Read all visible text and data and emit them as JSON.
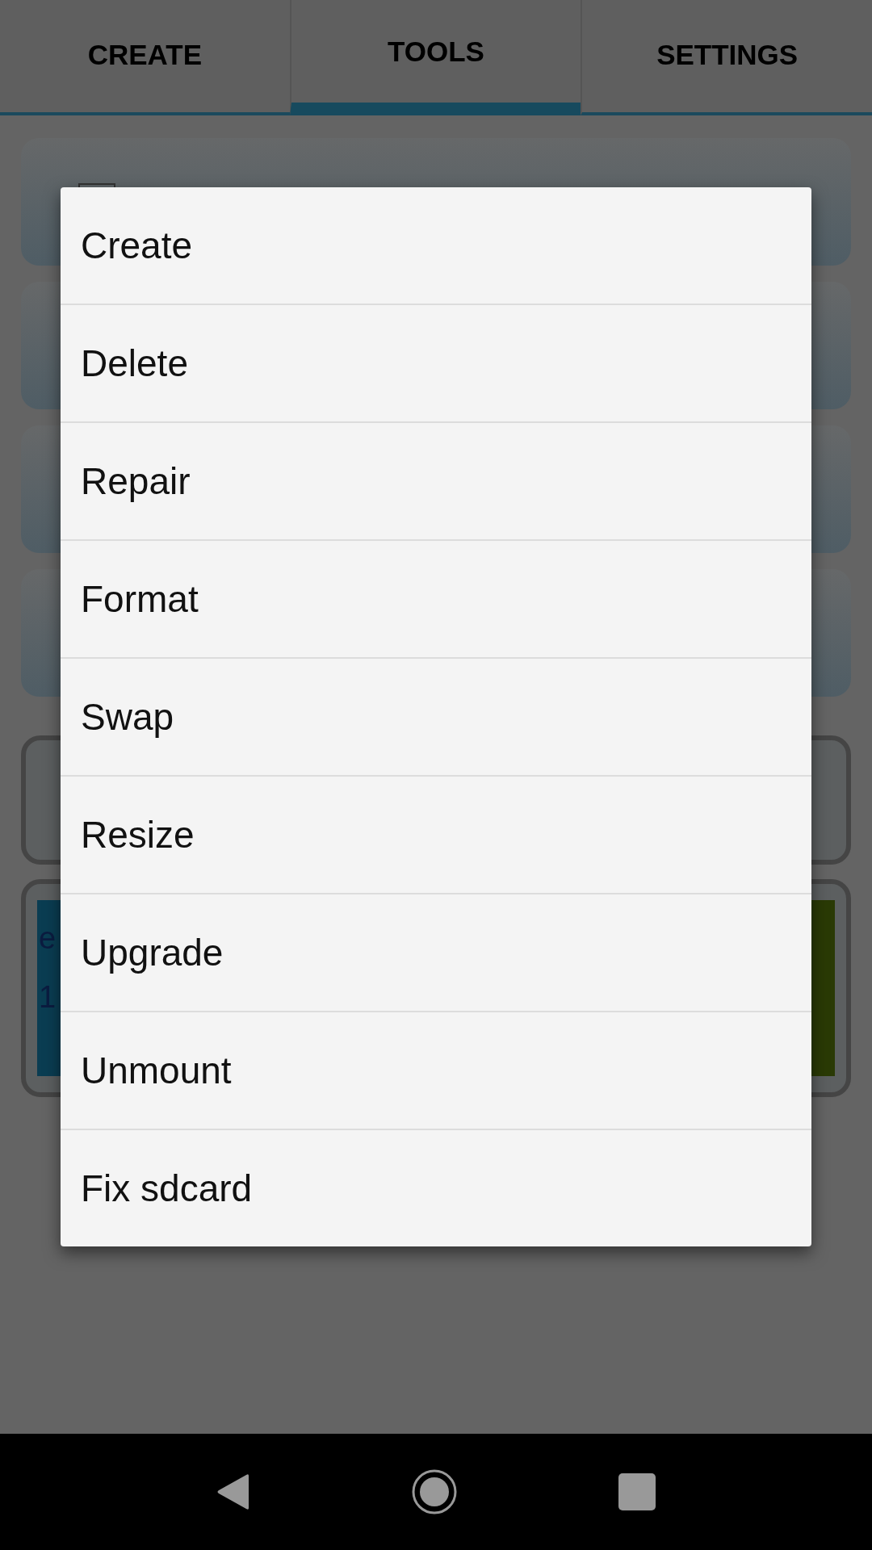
{
  "tabs": [
    {
      "label": "CREATE",
      "selected": false
    },
    {
      "label": "TOOLS",
      "selected": true
    },
    {
      "label": "SETTINGS",
      "selected": false
    }
  ],
  "background_panel": {
    "texts": [
      "e",
      "1"
    ]
  },
  "menu": {
    "items": [
      "Create",
      "Delete",
      "Repair",
      "Format",
      "Swap",
      "Resize",
      "Upgrade",
      "Unmount",
      "Fix sdcard"
    ]
  }
}
